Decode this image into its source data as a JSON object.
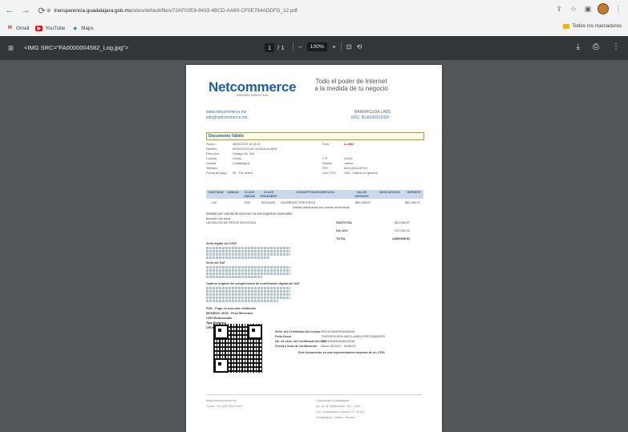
{
  "browser": {
    "url_host": "transparencia.guadalajara.gob.mx",
    "url_path": "/sites/default/files/72AF02E8-9433-4BCD-AA60-CF0E784ADDFD_12.pdf",
    "bookmarks": [
      {
        "label": "Gmail",
        "icon": "gmail-icon"
      },
      {
        "label": "YouTube",
        "icon": "youtube-icon"
      },
      {
        "label": "Maps",
        "icon": "maps-icon"
      }
    ],
    "all_bookmarks": "Todos los marcadores"
  },
  "pdf_toolbar": {
    "title": "<IMG SRC=\"FA0000004582_Log.jpg\">",
    "page_current": "1",
    "page_total": "/ 1",
    "zoom": "100%"
  },
  "invoice": {
    "logo": "Netcommerce",
    "logo_sub": "#WEBELEMENTALL",
    "tagline_1": "Todo el poder de Internet",
    "tagline_2": "a la medida de tu negocio",
    "contact_web": "www.netcommerce.mx",
    "contact_email": "info@netcommerce.mx",
    "issuer_name": "BARRACUDA LABS",
    "issuer_rfc": "RFC: BLA100312IU5",
    "valid_label": "Documento Válido",
    "fecha_label": "Fecha",
    "fecha_value": "28/02/2023 10:08:21",
    "folio_label": "Folio",
    "folio_value": "A-4582",
    "nombre_label": "Nombre",
    "nombre_value": "MUNICIPIO DE GUADALAJARA",
    "direccion_label": "Dirección",
    "direccion_value": "Hidalgo No. 400",
    "colonia_label": "Colonia",
    "colonia_value": "Centro",
    "cp_label": "C.P.",
    "cp_value": "44100",
    "ciudad_label": "Ciudad",
    "ciudad_value": "Guadalajara",
    "estado_label": "Estado",
    "estado_value": "Jalisco",
    "telefono_label": "Teléfono",
    "rfc_label": "RFC",
    "rfc_value": "MGU420214FG4",
    "forma_label": "Forma de pago",
    "forma_value": "99 - Por definir",
    "uso_label": "Uso CFDI",
    "uso_value": "G03 - Gastos en general",
    "table_headers": [
      "CANTIDAD",
      "UNIDAD",
      "CLAVE UNIDAD",
      "CLAVE PRODSERV",
      "CONCEPTO/DESCRIPCION",
      "VALOR UNITARIO",
      "DESCUENTOS",
      "IMPORTE"
    ],
    "row": {
      "cantidad": "1.00",
      "clave_unidad": "E48",
      "clave_prodserv": "82101600",
      "concepto": "FACEBOOK TERCEROS",
      "detalle": "Gastos efectuados por cuenta de terceros",
      "valor": "862,068.97",
      "importe": "862,068.97"
    },
    "note": "Gastos por cuenta de terceros no son ingresos nominales",
    "importe_letra_label": "Importe con letra",
    "importe_letra": "UN MILLON DE PESOS 00/100 M.N.",
    "subtotal_label": "SUBTOTAL",
    "subtotal_value": "862,068.97",
    "iva_label": "IVA 16%",
    "iva_value": "137,931.04",
    "total_label": "TOTAL",
    "total_value": "1,000,000.01",
    "sello_cfdi_label": "Sello digital del CFDI",
    "sello_sat_label": "Sello del SAT",
    "cadena_label": "Cadena original del complemento de certificación digital del SAT",
    "pue_label": "PUE - Pago en una sola exhibición",
    "moneda_label": "MONEDA: MXN - Peso Mexicano",
    "cfdi_rel_label": "CFDI Relacionado",
    "tipo_rel_label": "Tipo Relación",
    "cfdi_rel2_label": "CFDI Relacionado",
    "cert_rows": [
      {
        "label": "Serie del Certificado del emisor",
        "value": "00001000000504846444"
      },
      {
        "label": "Folio fiscal",
        "value": "72AF02E8-9433-4BCD-AA60-CF0E784ADDFD"
      },
      {
        "label": "No. de serie del Certificado del SAT",
        "value": "00001000000505142236"
      },
      {
        "label": "Fecha y hora de certificación",
        "value": "Marzo 08 2023 - 16:58:23"
      }
    ],
    "cert_note": "Este documento es una representación impresa de un CFDI",
    "footer_web": "www.netcommerce.mx",
    "footer_phone": "Conm: +52 (33) 3614 0101",
    "footer_addr_1": "Corporativo Guadalajara",
    "footer_addr_2": "Av. 16 de Septiembre 730 - 1403",
    "footer_addr_3": "Col. Guadalajara Centro C.P. 44100",
    "footer_addr_4": "Guadalajara, Jalisco. México"
  }
}
